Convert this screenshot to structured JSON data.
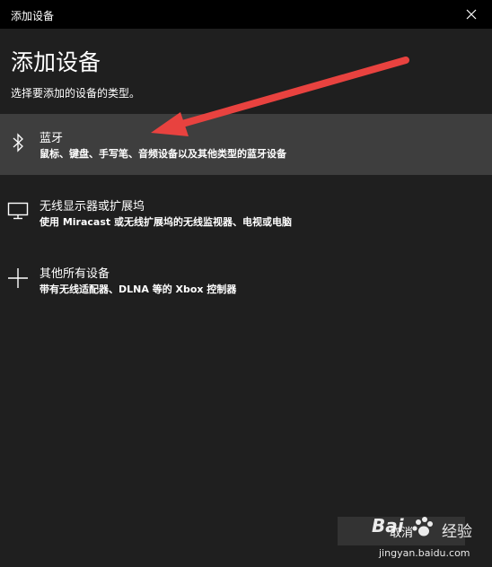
{
  "window": {
    "title": "添加设备",
    "close_icon": "close-icon"
  },
  "main": {
    "heading": "添加设备",
    "subtitle": "选择要添加的设备的类型。"
  },
  "options": [
    {
      "icon": "bluetooth-icon",
      "name": "蓝牙",
      "description": "鼠标、键盘、手写笔、音频设备以及其他类型的蓝牙设备",
      "selected": true
    },
    {
      "icon": "monitor-icon",
      "name": "无线显示器或扩展坞",
      "description": "使用 Miracast 或无线扩展坞的无线监视器、电视或电脑",
      "selected": false
    },
    {
      "icon": "plus-icon",
      "name": "其他所有设备",
      "description": "带有无线适配器、DLNA 等的 Xbox 控制器",
      "selected": false
    }
  ],
  "footer": {
    "cancel_label": "取消"
  },
  "watermark": {
    "logo": "Bai",
    "logo_cn": "经验",
    "url": "jingyan.baidu.com"
  },
  "colors": {
    "titlebar": "#000000",
    "background": "#1f1f1f",
    "selected_row": "#3e3e3e",
    "arrow": "#e8423f"
  }
}
